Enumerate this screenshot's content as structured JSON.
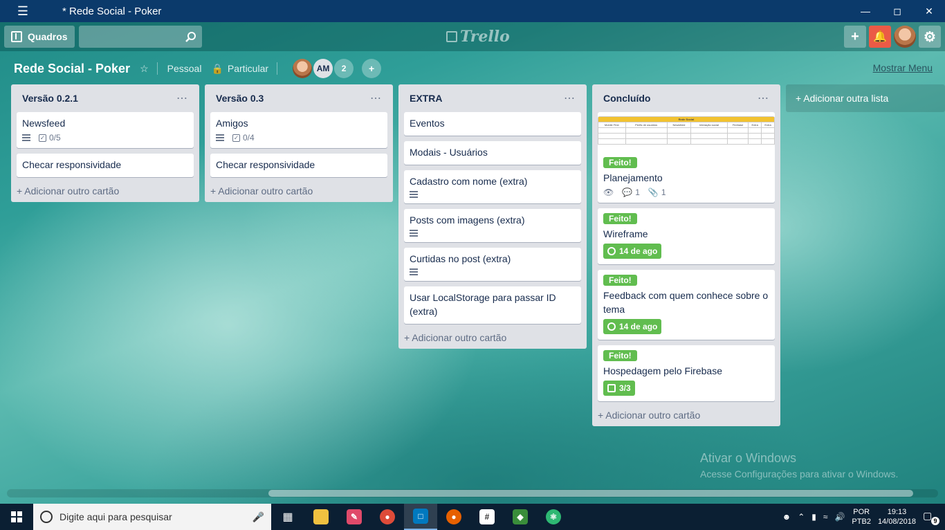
{
  "window": {
    "title": "* Rede Social - Poker",
    "menu_icon": "hamburger-icon",
    "minimize_icon": "minimize-icon",
    "maximize_icon": "maximize-icon",
    "close_icon": "close-icon"
  },
  "header": {
    "boards_label": "Quadros",
    "search_placeholder": "",
    "logo_text": "Trello",
    "add_icon": "plus-icon",
    "notifications_icon": "bell-icon",
    "settings_icon": "gear-icon"
  },
  "board": {
    "title": "Rede Social - Poker",
    "team": "Pessoal",
    "visibility": "Particular",
    "members": {
      "initials": "AM",
      "extra_count": "2"
    },
    "show_menu": "Mostrar Menu"
  },
  "lists": [
    {
      "title": "Versão 0.2.1",
      "cards": [
        {
          "title": "Newsfeed",
          "checklist": "0/5"
        },
        {
          "title": "Checar responsividade"
        }
      ],
      "add_card": "+ Adicionar outro cartão"
    },
    {
      "title": "Versão 0.3",
      "cards": [
        {
          "title": "Amigos",
          "checklist": "0/4"
        },
        {
          "title": "Checar responsividade"
        }
      ],
      "add_card": "+ Adicionar outro cartão"
    },
    {
      "title": "EXTRA",
      "cards": [
        {
          "title": "Eventos"
        },
        {
          "title": "Modais - Usuários"
        },
        {
          "title": "Cadastro com nome (extra)"
        },
        {
          "title": "Posts com imagens (extra)"
        },
        {
          "title": "Curtidas no post (extra)"
        },
        {
          "title": "Usar LocalStorage para passar ID (extra)"
        }
      ],
      "add_card": "+ Adicionar outro cartão"
    },
    {
      "title": "Concluído",
      "cover": {
        "title": "Rede Social",
        "columns": [
          "Mobile First",
          "Perfis de usuários",
          "Newsfeed",
          "Interação social",
          "Firebase",
          "Extra",
          "Extra"
        ]
      },
      "cards": [
        {
          "label": "Feito!",
          "title": "Planejamento",
          "comments": "1",
          "attachments": "1"
        },
        {
          "label": "Feito!",
          "title": "Wireframe",
          "due": "14 de ago"
        },
        {
          "label": "Feito!",
          "title": "Feedback com quem conhece sobre o tema",
          "due": "14 de ago"
        },
        {
          "label": "Feito!",
          "title": "Hospedagem pelo Firebase",
          "checklist": "3/3"
        }
      ],
      "add_card": "+ Adicionar outro cartão"
    }
  ],
  "add_list": "+ Adicionar outra lista",
  "watermark": {
    "line1": "Ativar o Windows",
    "line2": "Acesse Configurações para ativar o Windows."
  },
  "taskbar": {
    "search_placeholder": "Digite aqui para pesquisar",
    "lang_top": "POR",
    "lang_bottom": "PTB2",
    "time": "19:13",
    "date": "14/08/2018",
    "notifications_count": "9"
  },
  "colors": {
    "label_green": "#61bd4f",
    "notification_red": "#eb5a46",
    "titlebar": "#0b3a6b"
  }
}
